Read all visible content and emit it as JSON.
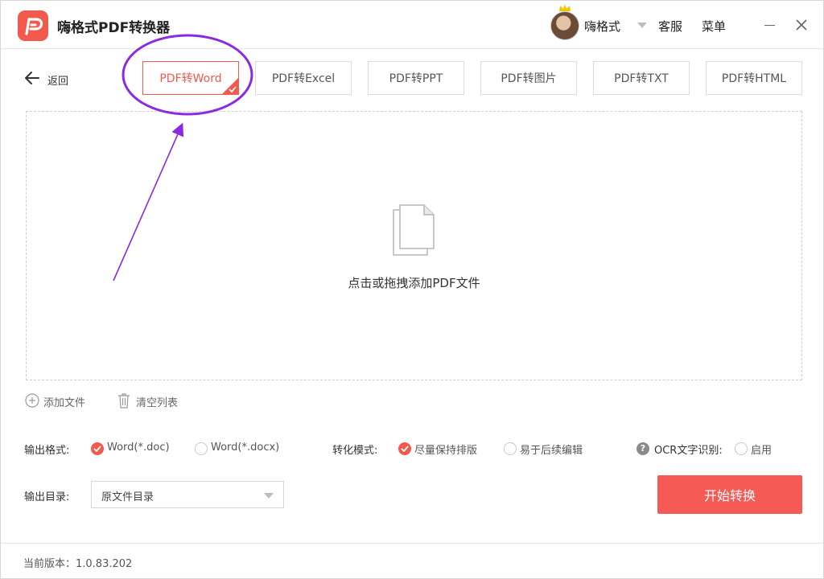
{
  "window": {
    "title": "嗨格式PDF转换器",
    "username": "嗨格式",
    "service": "客服",
    "menu": "菜单"
  },
  "nav": {
    "back_label": "返回"
  },
  "tabs": [
    {
      "label": "PDF转Word",
      "active": true
    },
    {
      "label": "PDF转Excel",
      "active": false
    },
    {
      "label": "PDF转PPT",
      "active": false
    },
    {
      "label": "PDF转图片",
      "active": false
    },
    {
      "label": "PDF转TXT",
      "active": false
    },
    {
      "label": "PDF转HTML",
      "active": false
    }
  ],
  "dropzone": {
    "text": "点击或拖拽添加PDF文件"
  },
  "file_actions": {
    "add_label": "添加文件",
    "clear_label": "清空列表"
  },
  "options": {
    "format_label": "输出格式:",
    "format_choices": [
      {
        "label": "Word(*.doc)",
        "checked": true
      },
      {
        "label": "Word(*.docx)",
        "checked": false
      }
    ],
    "mode_label": "转化模式:",
    "mode_choices": [
      {
        "label": "尽量保持排版",
        "checked": true
      },
      {
        "label": "易于后续编辑",
        "checked": false
      }
    ],
    "ocr_label": "OCR文字识别:",
    "ocr_choice": {
      "label": "启用",
      "checked": false
    }
  },
  "output_dir": {
    "label": "输出目录:",
    "value": "原文件目录"
  },
  "start_button": "开始转换",
  "footer": {
    "version": "当前版本：1.0.83.202"
  },
  "colors": {
    "accent": "#f25a4d",
    "button": "#f55a55",
    "annotation": "#8a2be2"
  }
}
